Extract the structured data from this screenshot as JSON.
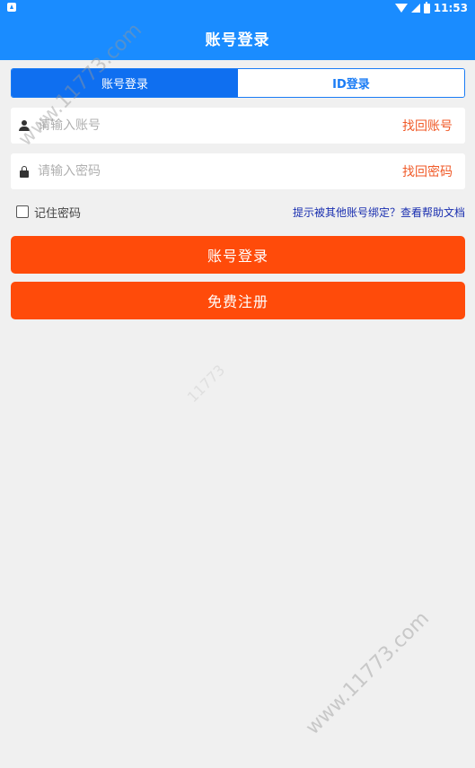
{
  "status_bar": {
    "time": "11:53",
    "icons": [
      "app-notification-icon",
      "wifi-icon",
      "cellular-icon",
      "battery-icon"
    ]
  },
  "app_bar": {
    "title": "账号登录"
  },
  "tabs": [
    {
      "label": "账号登录",
      "active": true
    },
    {
      "label": "ID登录",
      "active": false
    }
  ],
  "form": {
    "account": {
      "placeholder": "请输入账号",
      "value": "",
      "icon": "user-icon",
      "link": "找回账号"
    },
    "password": {
      "placeholder": "请输入密码",
      "value": "",
      "icon": "lock-icon",
      "link": "找回密码"
    },
    "remember": {
      "label": "记住密码",
      "checked": false
    },
    "help_link": "提示被其他账号绑定？查看帮助文档"
  },
  "buttons": {
    "login": "账号登录",
    "register": "免费注册"
  },
  "watermarks": [
    "www.11773.com",
    "11773",
    "www.11773.com"
  ],
  "colors": {
    "primary_blue": "#1a8cff",
    "accent_orange": "#ff4b0a",
    "link_orange": "#f05a28",
    "help_link_blue": "#1a2fb0",
    "background": "#f0f0f0"
  }
}
